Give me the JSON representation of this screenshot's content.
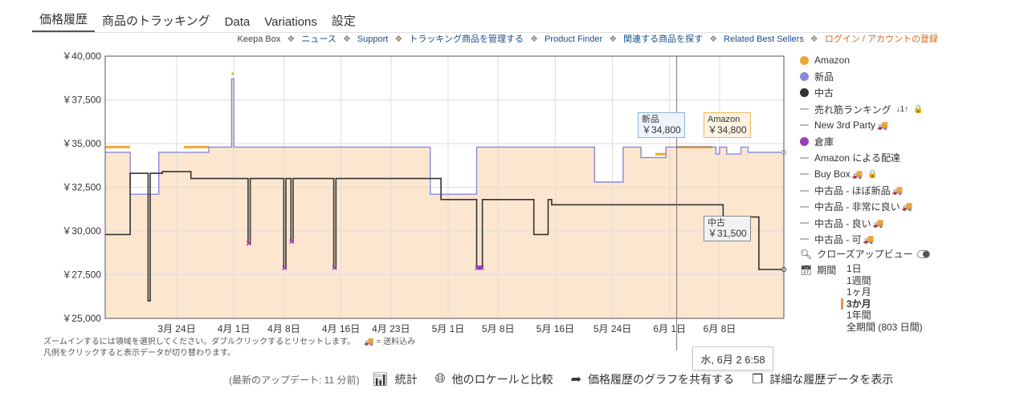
{
  "tabs": [
    "価格履歴",
    "商品のトラッキング",
    "Data",
    "Variations",
    "設定"
  ],
  "toplinks": {
    "keepa_box": "Keepa Box",
    "links": [
      "ニュース",
      "Support",
      "トラッキング商品を管理する",
      "Product Finder",
      "関連する商品を探す",
      "Related Best Sellers"
    ],
    "login": "ログイン / アカウントの登録",
    "separator": "❖"
  },
  "legend": [
    {
      "label": "Amazon",
      "kind": "dot",
      "color": "#f0a830"
    },
    {
      "label": "新品",
      "kind": "dot",
      "color": "#8888dd"
    },
    {
      "label": "中古",
      "kind": "dot",
      "color": "#333333"
    },
    {
      "label": "売れ筋ランキング",
      "kind": "line",
      "suffix": "↓1↑",
      "locked": true
    },
    {
      "label": "New 3rd Party",
      "kind": "line",
      "truck": true
    },
    {
      "label": "倉庫",
      "kind": "dot",
      "color": "#9b3fb5"
    },
    {
      "label": "Amazon による配達",
      "kind": "line"
    },
    {
      "label": "Buy Box",
      "kind": "line",
      "truck": true,
      "locked": true
    },
    {
      "label": "中古品 - ほぼ新品",
      "kind": "line",
      "truck": true
    },
    {
      "label": "中古品 - 非常に良い",
      "kind": "line",
      "truck": true
    },
    {
      "label": "中古品 - 良い",
      "kind": "line",
      "truck": true
    },
    {
      "label": "中古品 - 可",
      "kind": "line",
      "truck": true
    }
  ],
  "closeup": {
    "label": "クローズアップビュー"
  },
  "period": {
    "label": "期間",
    "options": [
      "1日",
      "1週間",
      "1ヶ月",
      "3か月",
      "1年間",
      "全期間 (803 日間)"
    ],
    "selected": "3か月"
  },
  "hint": {
    "line1": "ズームインするには領域を選択してください。ダブルクリックするとリセットします。",
    "shipping": "= 送料込み",
    "line2": "凡例をクリックすると表示データが切り替わります。"
  },
  "footer": {
    "updated": "(最新のアップデート: 11 分前)",
    "stats": "統計",
    "compare": "他のロケールと比較",
    "share": "価格履歴のグラフを共有する",
    "details": "詳細な履歴データを表示"
  },
  "tooltips": {
    "new": {
      "name": "新品",
      "value": "￥34,800"
    },
    "amazon": {
      "name": "Amazon",
      "value": "￥34,800"
    },
    "used": {
      "name": "中古",
      "value": "￥31,500"
    },
    "date": "水, 6月 2 6:58"
  },
  "chart_data": {
    "type": "line",
    "ylim": [
      25000,
      40000
    ],
    "yticks": [
      25000,
      27500,
      30000,
      32500,
      35000,
      37500,
      40000
    ],
    "ytick_labels": [
      "￥25,000",
      "￥27,500",
      "￥30,000",
      "￥32,500",
      "￥35,000",
      "￥37,500",
      "￥40,000"
    ],
    "xlim": [
      "2021-03-14",
      "2021-06-17"
    ],
    "xticks": [
      "2021-03-24",
      "2021-04-01",
      "2021-04-08",
      "2021-04-16",
      "2021-04-23",
      "2021-05-01",
      "2021-05-08",
      "2021-05-16",
      "2021-05-24",
      "2021-06-01",
      "2021-06-08"
    ],
    "xtick_labels": [
      "3月 24日",
      "4月 1日",
      "4月 8日",
      "4月 16日",
      "4月 23日",
      "5月 1日",
      "5月 8日",
      "5月 16日",
      "5月 24日",
      "6月 1日",
      "6月 8日"
    ],
    "crosshair_date": "2021-06-02",
    "series": [
      {
        "name": "Amazon",
        "color": "#f0a830",
        "points": [
          [
            "2021-03-14",
            34800
          ],
          [
            "2021-03-17.5",
            34800
          ],
          [
            "2021-03-17.5",
            null
          ],
          [
            "2021-03-25",
            34800
          ],
          [
            "2021-03-28.5",
            34800
          ],
          [
            "2021-03-28.5",
            null
          ],
          [
            "2021-03-31.7",
            39000
          ],
          [
            "2021-04-01",
            39000
          ],
          [
            "2021-04-01",
            null
          ],
          [
            "2021-05-30",
            34400
          ],
          [
            "2021-05-31.5",
            34400
          ],
          [
            "2021-05-31.5",
            null
          ],
          [
            "2021-06-02",
            34800
          ],
          [
            "2021-06-07",
            34800
          ],
          [
            "2021-06-07",
            null
          ]
        ]
      },
      {
        "name": "新品",
        "color": "#8888dd",
        "points": [
          [
            "2021-03-14",
            34500
          ],
          [
            "2021-03-17.5",
            34500
          ],
          [
            "2021-03-17.5",
            32100
          ],
          [
            "2021-03-21.5",
            32100
          ],
          [
            "2021-03-21.5",
            34500
          ],
          [
            "2021-03-28.5",
            34500
          ],
          [
            "2021-03-28.5",
            34800
          ],
          [
            "2021-03-31.7",
            34800
          ],
          [
            "2021-03-31.7",
            38700
          ],
          [
            "2021-04-01",
            38700
          ],
          [
            "2021-04-01",
            34800
          ],
          [
            "2021-04-28.5",
            34800
          ],
          [
            "2021-04-28.5",
            32100
          ],
          [
            "2021-05-05",
            32100
          ],
          [
            "2021-05-05",
            34800
          ],
          [
            "2021-05-21.5",
            34800
          ],
          [
            "2021-05-21.5",
            32800
          ],
          [
            "2021-05-25.5",
            32800
          ],
          [
            "2021-05-25.5",
            34800
          ],
          [
            "2021-05-28",
            34800
          ],
          [
            "2021-05-28",
            34200
          ],
          [
            "2021-05-31.5",
            34200
          ],
          [
            "2021-05-31.5",
            34800
          ],
          [
            "2021-06-07.5",
            34800
          ],
          [
            "2021-06-07.5",
            34400
          ],
          [
            "2021-06-08",
            34400
          ],
          [
            "2021-06-08",
            34800
          ],
          [
            "2021-06-09",
            34800
          ],
          [
            "2021-06-09",
            34400
          ],
          [
            "2021-06-11",
            34400
          ],
          [
            "2021-06-11",
            34800
          ],
          [
            "2021-06-12",
            34800
          ],
          [
            "2021-06-12",
            34500
          ],
          [
            "2021-06-17",
            34500
          ]
        ]
      },
      {
        "name": "中古",
        "color": "#333333",
        "points": [
          [
            "2021-03-14",
            29800
          ],
          [
            "2021-03-17.5",
            29800
          ],
          [
            "2021-03-17.5",
            33300
          ],
          [
            "2021-03-20",
            33300
          ],
          [
            "2021-03-20",
            26000
          ],
          [
            "2021-03-20.3",
            26000
          ],
          [
            "2021-03-20.3",
            33300
          ],
          [
            "2021-03-22",
            33300
          ],
          [
            "2021-03-22",
            33400
          ],
          [
            "2021-03-26",
            33400
          ],
          [
            "2021-03-26",
            33000
          ],
          [
            "2021-04-03",
            33000
          ],
          [
            "2021-04-03",
            29300
          ],
          [
            "2021-04-03.3",
            29300
          ],
          [
            "2021-04-03.3",
            33000
          ],
          [
            "2021-04-08",
            33000
          ],
          [
            "2021-04-08",
            27900
          ],
          [
            "2021-04-08.3",
            27900
          ],
          [
            "2021-04-08.3",
            33000
          ],
          [
            "2021-04-09",
            33000
          ],
          [
            "2021-04-09",
            29400
          ],
          [
            "2021-04-09.3",
            29400
          ],
          [
            "2021-04-09.3",
            33000
          ],
          [
            "2021-04-15",
            33000
          ],
          [
            "2021-04-15",
            27900
          ],
          [
            "2021-04-15.3",
            27900
          ],
          [
            "2021-04-15.3",
            33000
          ],
          [
            "2021-04-30",
            33000
          ],
          [
            "2021-04-30",
            31800
          ],
          [
            "2021-05-05",
            31800
          ],
          [
            "2021-05-05",
            27900
          ],
          [
            "2021-05-05.8",
            27900
          ],
          [
            "2021-05-05.8",
            31800
          ],
          [
            "2021-05-13",
            31800
          ],
          [
            "2021-05-13",
            29800
          ],
          [
            "2021-05-15",
            29800
          ],
          [
            "2021-05-15",
            31800
          ],
          [
            "2021-05-15.5",
            31800
          ],
          [
            "2021-05-15.5",
            31500
          ],
          [
            "2021-06-08.5",
            31500
          ],
          [
            "2021-06-08.5",
            30800
          ],
          [
            "2021-06-13.5",
            30800
          ],
          [
            "2021-06-13.5",
            27800
          ],
          [
            "2021-06-17",
            27800
          ]
        ]
      }
    ],
    "warehouse_points": [
      [
        "2021-04-03.1",
        29300
      ],
      [
        "2021-04-08.1",
        27900
      ],
      [
        "2021-04-09.1",
        29400
      ],
      [
        "2021-04-15.1",
        27900
      ],
      [
        "2021-05-05.1",
        27900
      ],
      [
        "2021-05-05.4",
        27900
      ],
      [
        "2021-05-05.7",
        27900
      ]
    ]
  }
}
